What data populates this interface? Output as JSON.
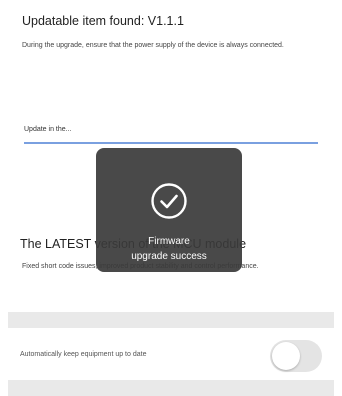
{
  "header": {
    "title": "Updatable item found: V1.1.1",
    "description": "During the upgrade, ensure that the power supply of the device is always connected."
  },
  "progress": {
    "label": "Update in the...",
    "value": 1.0,
    "color": "#7aa0e0"
  },
  "latest": {
    "title": "The LATEST version of the MCU module",
    "description": "Fixed short code issues, improved product stability and control performance."
  },
  "settings": {
    "auto_update_label": "Automatically keep equipment up to date",
    "auto_update_enabled": false
  },
  "toast": {
    "icon": "check-circle-icon",
    "message": "Firmware\nupgrade success"
  },
  "colors": {
    "background": "#ffffff",
    "toast_background": "#3a3a3a",
    "band": "#e9e9e9",
    "toggle_off": "#e4e4e4"
  }
}
